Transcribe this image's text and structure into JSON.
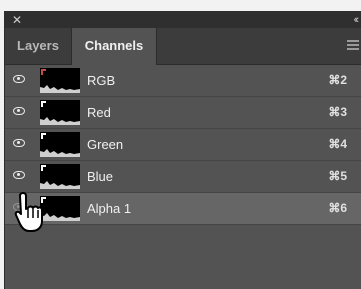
{
  "window": {
    "close_icon": "close-icon",
    "collapse_icon": "collapse-panel-icon"
  },
  "tabs": [
    {
      "label": "Layers",
      "active": false
    },
    {
      "label": "Channels",
      "active": true
    }
  ],
  "panel_menu_icon": "panel-menu-icon",
  "channels": [
    {
      "name": "RGB",
      "shortcut": "⌘2",
      "visible": true,
      "selected": false,
      "tint": "#c44a4a"
    },
    {
      "name": "Red",
      "shortcut": "⌘3",
      "visible": true,
      "selected": false,
      "tint": "#ffffff"
    },
    {
      "name": "Green",
      "shortcut": "⌘4",
      "visible": true,
      "selected": false,
      "tint": "#ffffff"
    },
    {
      "name": "Blue",
      "shortcut": "⌘5",
      "visible": true,
      "selected": false,
      "tint": "#ffffff"
    },
    {
      "name": "Alpha 1",
      "shortcut": "⌘6",
      "visible": false,
      "selected": true,
      "tint": "#ffffff"
    }
  ],
  "colors": {
    "panel_bg": "#535353",
    "selected_row": "#666666",
    "tab_bar": "#3c3c3c"
  }
}
